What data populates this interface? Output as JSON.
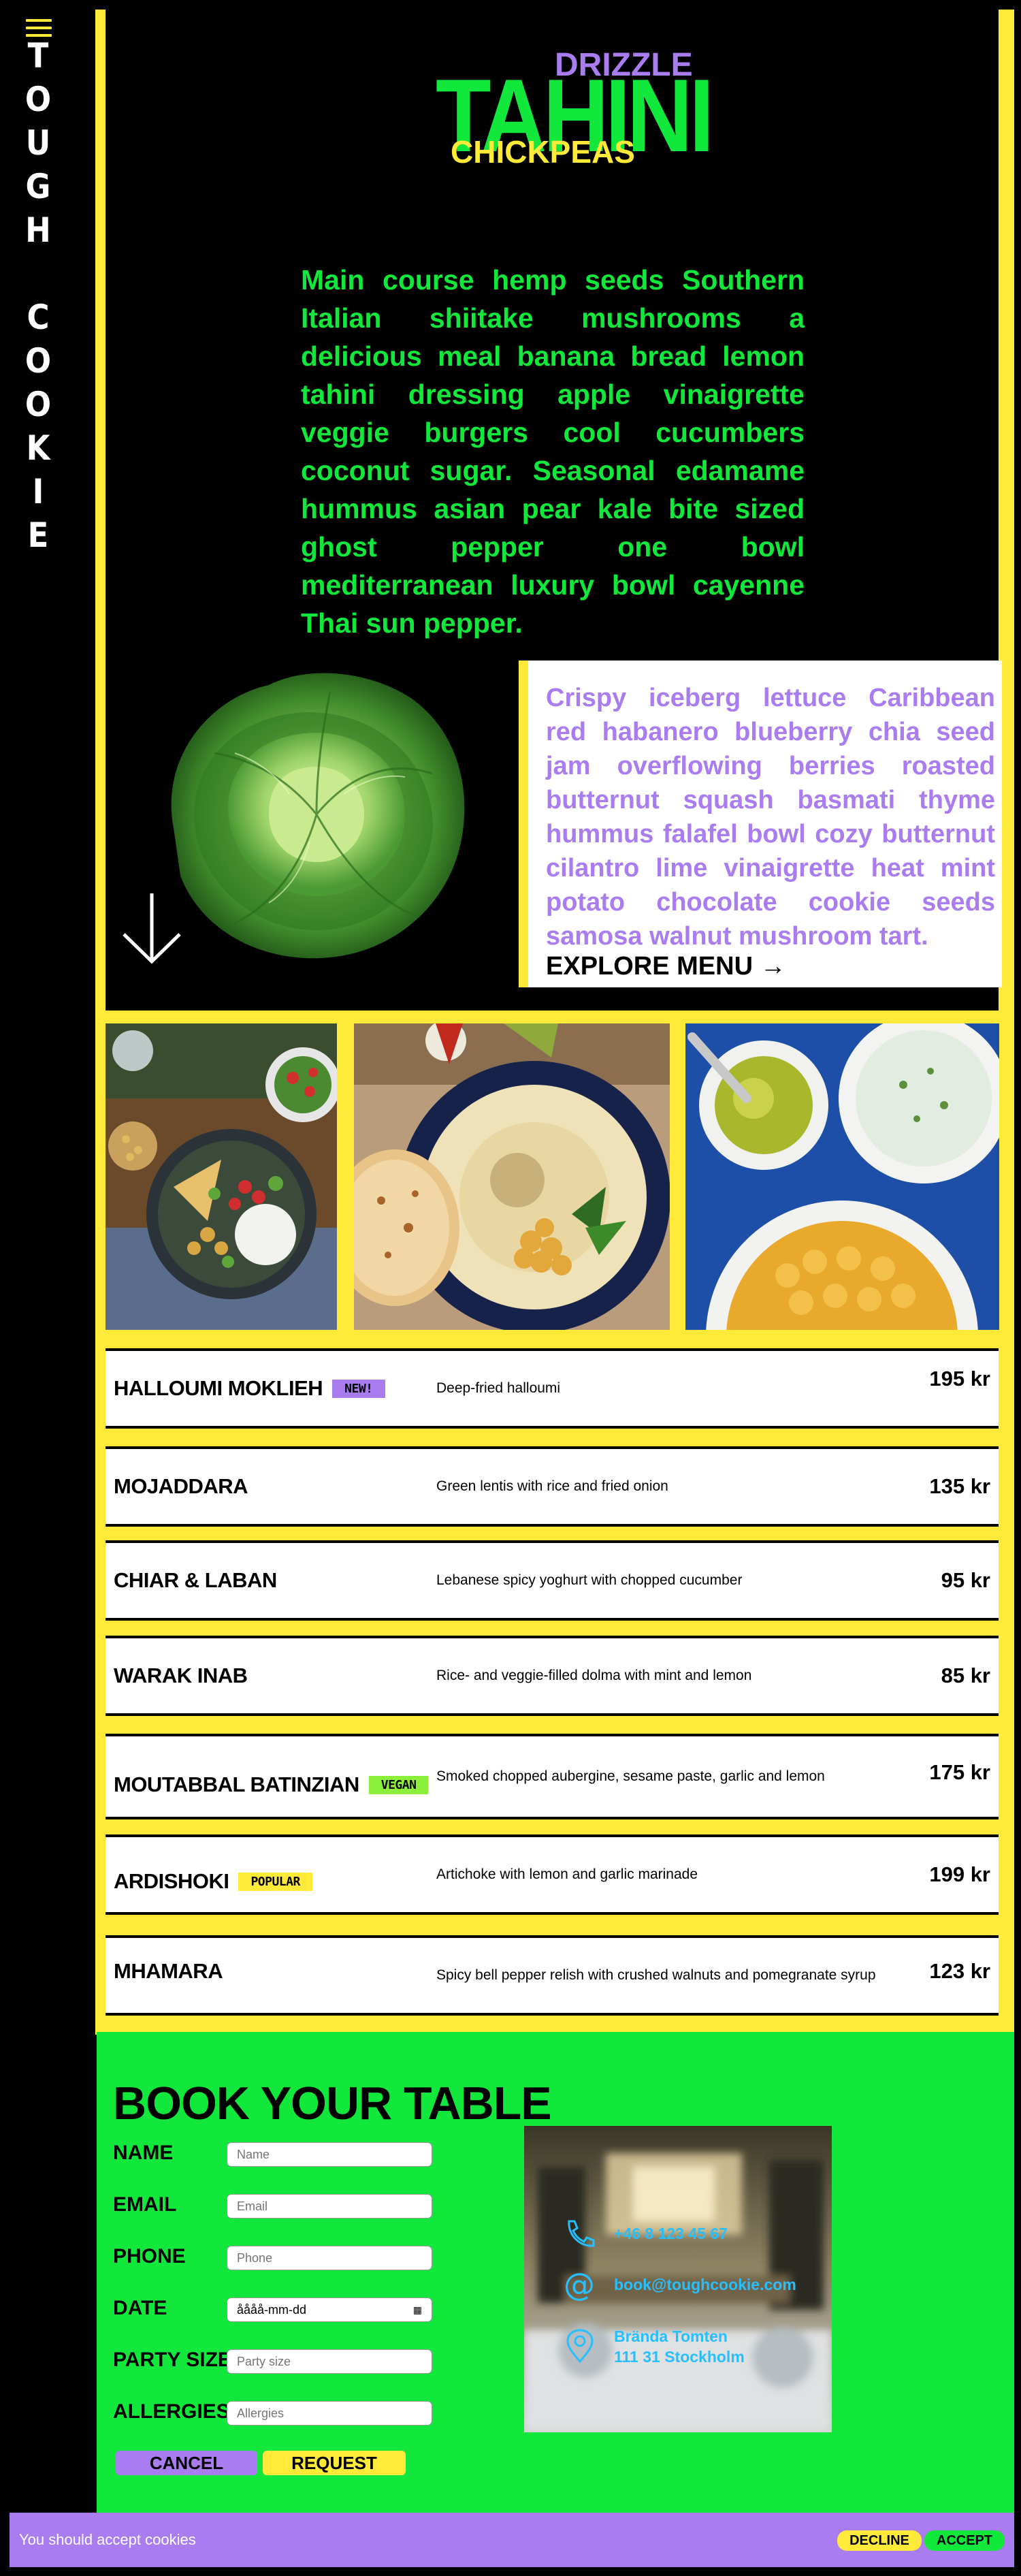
{
  "brand": {
    "name": "TOUGH COOKIE",
    "letters": [
      "T",
      "O",
      "U",
      "G",
      "H",
      "",
      "C",
      "O",
      "O",
      "K",
      "I",
      "E"
    ]
  },
  "logo": {
    "top": "DRIZZLE",
    "main": "TAHINI",
    "bottom": "CHICKPEAS"
  },
  "intro": "Main course hemp seeds Southern Italian shiitake mushrooms a delicious meal banana bread lemon tahini dressing apple vinaigrette veggie burgers cool cucumbers coconut sugar. Seasonal edamame hummus asian pear kale bite sized ghost pepper one bowl mediterranean luxury bowl cayenne Thai sun pepper.",
  "card": {
    "text": "Crispy iceberg lettuce Caribbean red habanero blueberry chia seed jam overflowing berries roasted butternut squash basmati thyme hummus falafel bowl cozy butternut cilantro lime vinaigrette heat mint potato chocolate cookie seeds samosa walnut mushroom tart.",
    "cta": "EXPLORE MENU"
  },
  "menu": [
    {
      "name": "HALLOUMI MOKLIEH",
      "badge": "NEW!",
      "badge_color": "#a97cf0",
      "desc": "Deep-fried halloumi",
      "price": "195 kr"
    },
    {
      "name": "MOJADDARA",
      "badge": "",
      "badge_color": "",
      "desc": "Green lentis with rice and fried onion",
      "price": "135 kr"
    },
    {
      "name": "CHIAR & LABAN",
      "badge": "",
      "badge_color": "",
      "desc": "Lebanese spicy yoghurt with chopped cucumber",
      "price": "95 kr"
    },
    {
      "name": "WARAK INAB",
      "badge": "",
      "badge_color": "",
      "desc": "Rice- and veggie-filled dolma with mint and lemon",
      "price": "85 kr"
    },
    {
      "name": "MOUTABBAL BATINZIAN",
      "badge": "VEGAN",
      "badge_color": "#8cf03b",
      "desc": "Smoked chopped aubergine, sesame paste, garlic and lemon",
      "price": "175 kr"
    },
    {
      "name": "ARDISHOKI",
      "badge": "POPULAR",
      "badge_color": "#ffea3a",
      "desc": "Artichoke with lemon and garlic marinade",
      "price": "199 kr"
    },
    {
      "name": "MHAMARA",
      "badge": "",
      "badge_color": "",
      "desc": "Spicy bell pepper relish with crushed walnuts and pomegranate syrup",
      "price": "123 kr"
    }
  ],
  "booking": {
    "title": "BOOK YOUR TABLE",
    "fields": [
      {
        "label": "NAME",
        "placeholder": "Name"
      },
      {
        "label": "EMAIL",
        "placeholder": "Email"
      },
      {
        "label": "PHONE",
        "placeholder": "Phone"
      },
      {
        "label": "DATE",
        "placeholder": "åååå-mm-dd"
      },
      {
        "label": "PARTY SIZE",
        "placeholder": "Party size"
      },
      {
        "label": "ALLERGIES",
        "placeholder": "Allergies"
      }
    ],
    "cancel": "CANCEL",
    "request": "REQUEST"
  },
  "contact": {
    "phone": "+46 8 123 45 67",
    "email": "book@toughcookie.com",
    "address_line1": "Brända Tomten",
    "address_line2": "111 31 Stockholm"
  },
  "cookie": {
    "text": "You should accept cookies",
    "decline": "DECLINE",
    "accept": "ACCEPT"
  },
  "colors": {
    "green": "#11e83b",
    "yellow": "#ffea3a",
    "purple": "#a97cf0",
    "blue": "#28bfff"
  }
}
